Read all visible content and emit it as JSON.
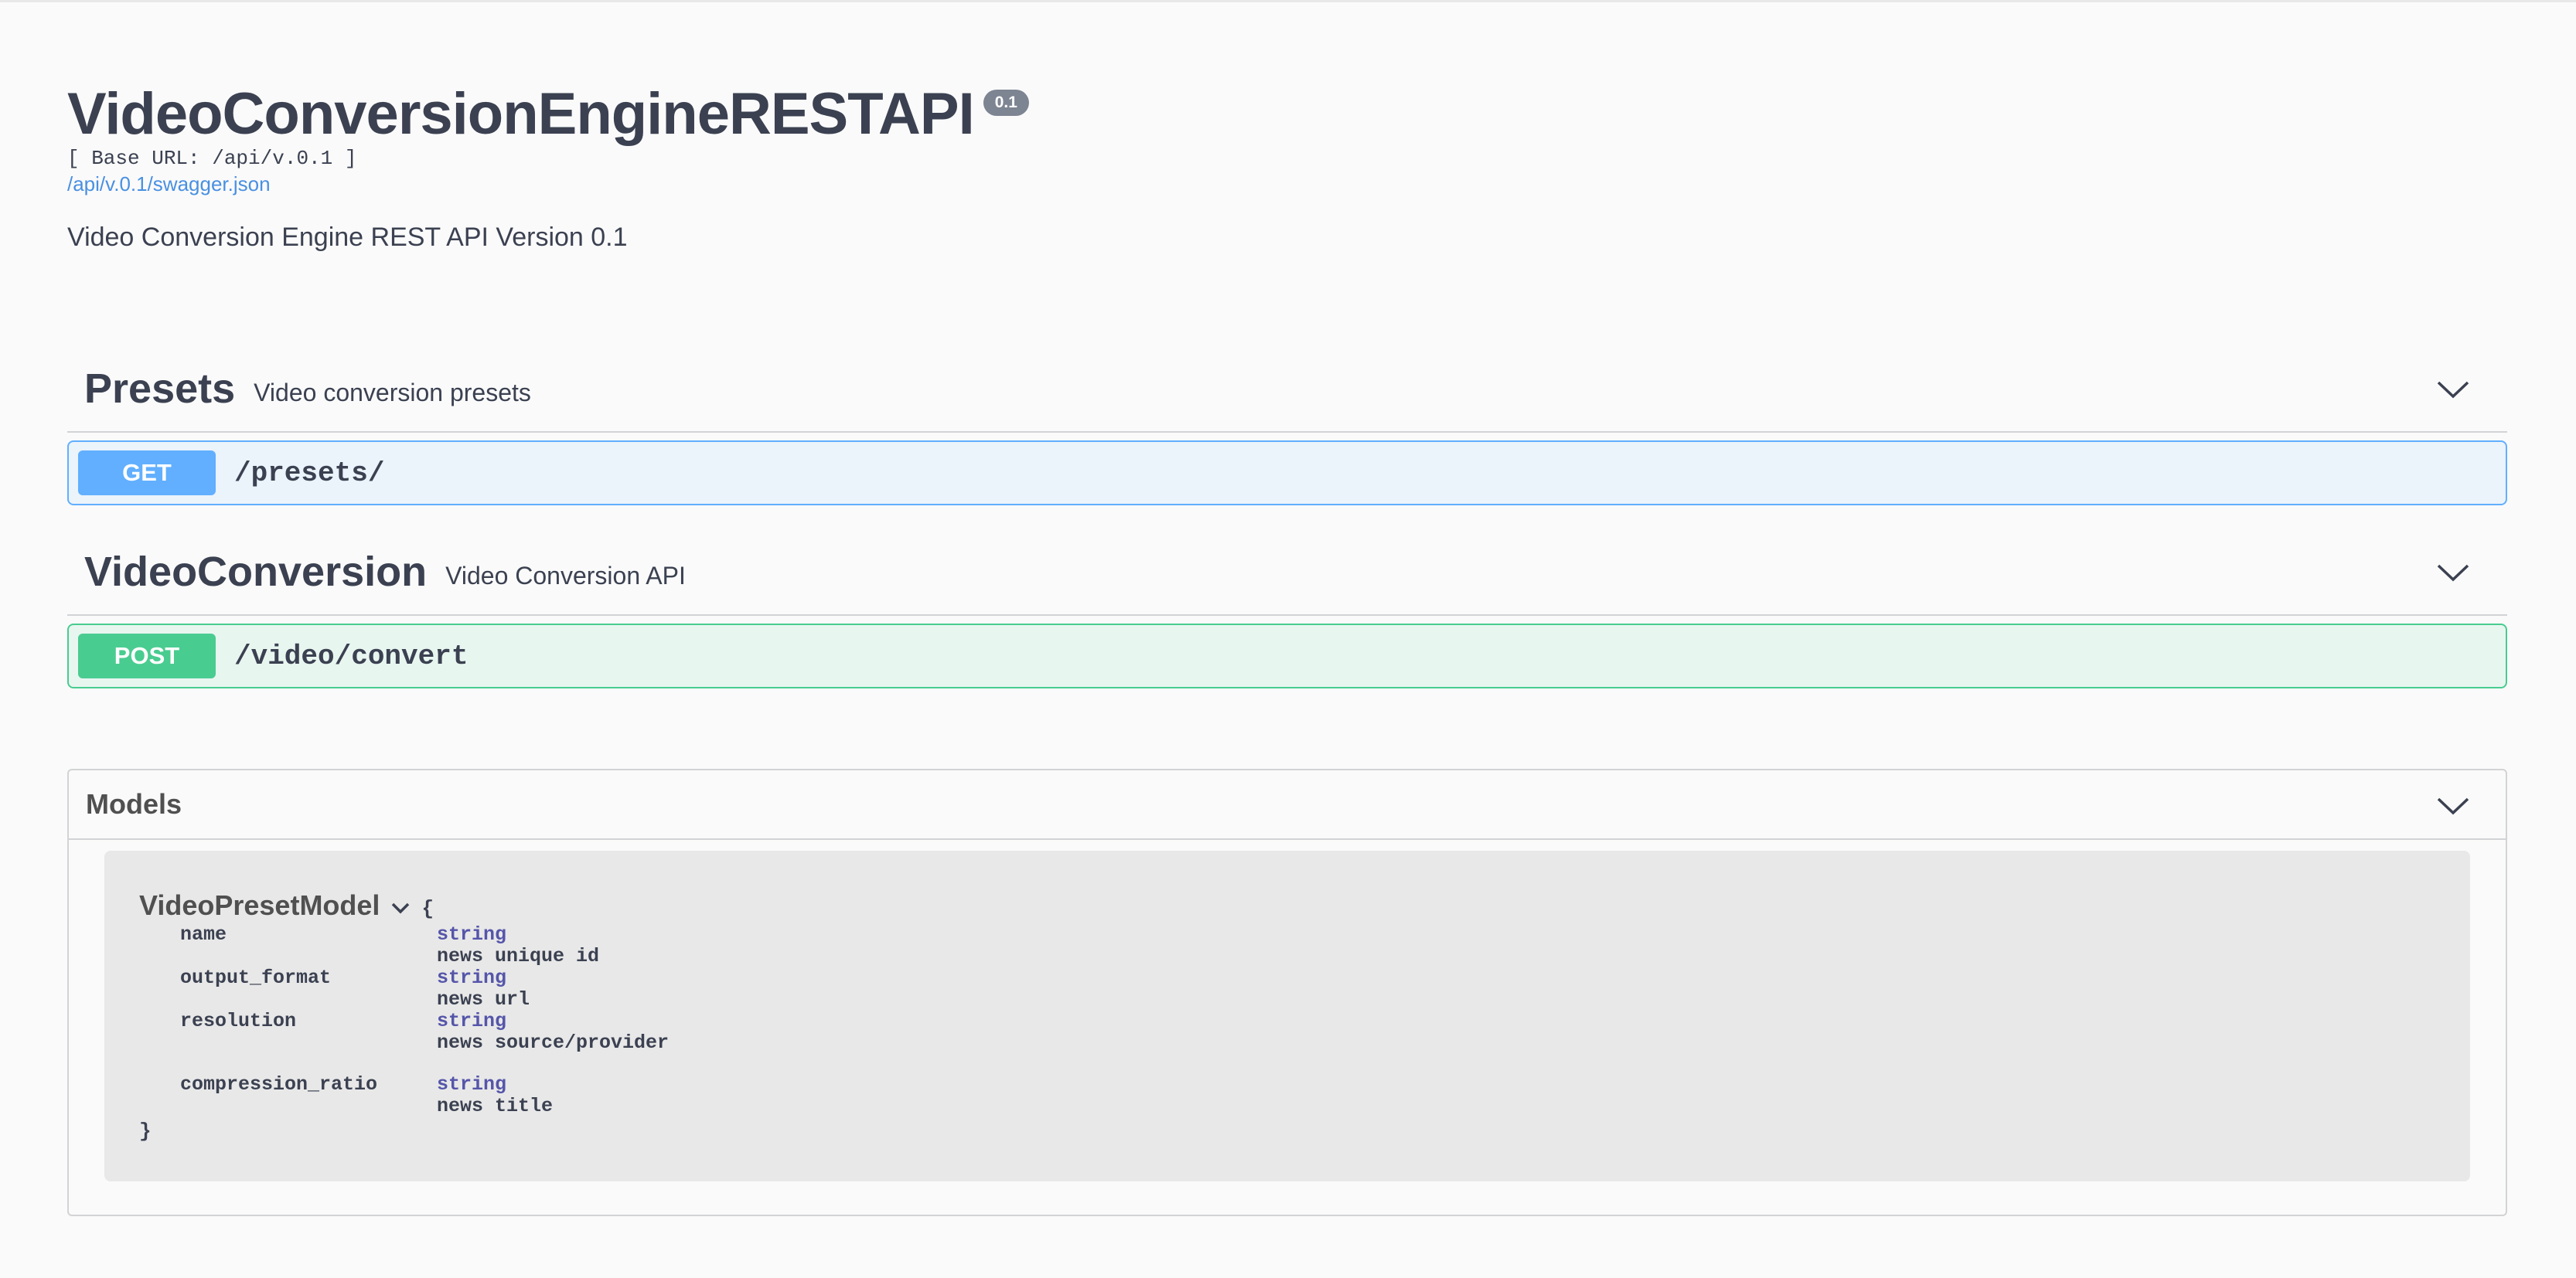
{
  "info": {
    "title": "VideoConversionEngineRESTAPI",
    "version": "0.1",
    "base_url": "[ Base URL: /api/v.0.1 ]",
    "spec_link": "/api/v.0.1/swagger.json",
    "description": "Video Conversion Engine REST API Version 0.1"
  },
  "tags": [
    {
      "name": "Presets",
      "description": "Video conversion presets",
      "operation": {
        "method": "GET",
        "path": "/presets/"
      }
    },
    {
      "name": "VideoConversion",
      "description": "Video Conversion API",
      "operation": {
        "method": "POST",
        "path": "/video/convert"
      }
    }
  ],
  "models": {
    "title": "Models",
    "model": {
      "name": "VideoPresetModel",
      "open_brace": "{",
      "close_brace": "}",
      "properties": [
        {
          "name": "name",
          "type": "string",
          "description": "news unique id"
        },
        {
          "name": "output_format",
          "type": "string",
          "description": "news url"
        },
        {
          "name": "resolution",
          "type": "string",
          "description": "news source/provider"
        },
        {
          "name": "compression_ratio",
          "type": "string",
          "description": "news title"
        }
      ]
    }
  },
  "colors": {
    "get": "#61affe",
    "post": "#49cc90",
    "text": "#3b4151",
    "link": "#4990e2"
  }
}
